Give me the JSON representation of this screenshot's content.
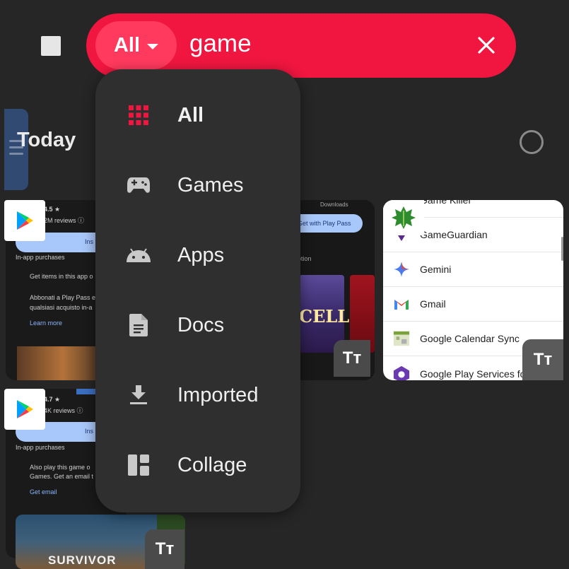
{
  "search": {
    "filter_label": "All",
    "query": "game"
  },
  "today": {
    "title": "Today"
  },
  "dropdown": {
    "items": [
      {
        "label": "All",
        "icon": "grid-icon",
        "active": true
      },
      {
        "label": "Games",
        "icon": "gamepad-icon"
      },
      {
        "label": "Apps",
        "icon": "android-icon"
      },
      {
        "label": "Docs",
        "icon": "document-icon"
      },
      {
        "label": "Imported",
        "icon": "download-icon"
      },
      {
        "label": "Collage",
        "icon": "collage-icon"
      }
    ]
  },
  "cards": {
    "left1": {
      "rating": "4.5 ★",
      "reviews": "2M reviews ⓘ",
      "install": "Ins",
      "in_app": "In-app purchases",
      "line1": "Get items in this app o",
      "line2": "Abbonati a Play Pass e",
      "line3": "qualsiasi acquisto in-a",
      "learn_more": "Learn more"
    },
    "left2": {
      "rating": "4.7 ★",
      "reviews": "4K reviews ⓘ",
      "install": "Ins",
      "in_app": "In-app purchases",
      "line1": "Also play this game o",
      "line2": "Games. Get an email t",
      "get_email": "Get email"
    },
    "mid": {
      "play_pass": "Get with Play Pass",
      "ption": "ption",
      "downloads": "Downloads",
      "game_art": "CELLS"
    },
    "right": {
      "apps": [
        {
          "name": "Game Killer",
          "icon": "game-killer-icon"
        },
        {
          "name": "GameGuardian",
          "icon": "gameguardian-icon"
        },
        {
          "name": "Gemini",
          "icon": "gemini-icon"
        },
        {
          "name": "Gmail",
          "icon": "gmail-icon"
        },
        {
          "name": "Google Calendar Sync",
          "icon": "calendar-sync-icon"
        },
        {
          "name": "Google Play Services for AR",
          "icon": "ar-services-icon"
        }
      ]
    },
    "bottom": {
      "game_title": "SURVIVOR"
    },
    "tt_label": "Tт"
  },
  "colors": {
    "accent": "#f0163f",
    "chip": "#ff3a5e",
    "background": "#262626",
    "menu": "#2f2f2f"
  }
}
